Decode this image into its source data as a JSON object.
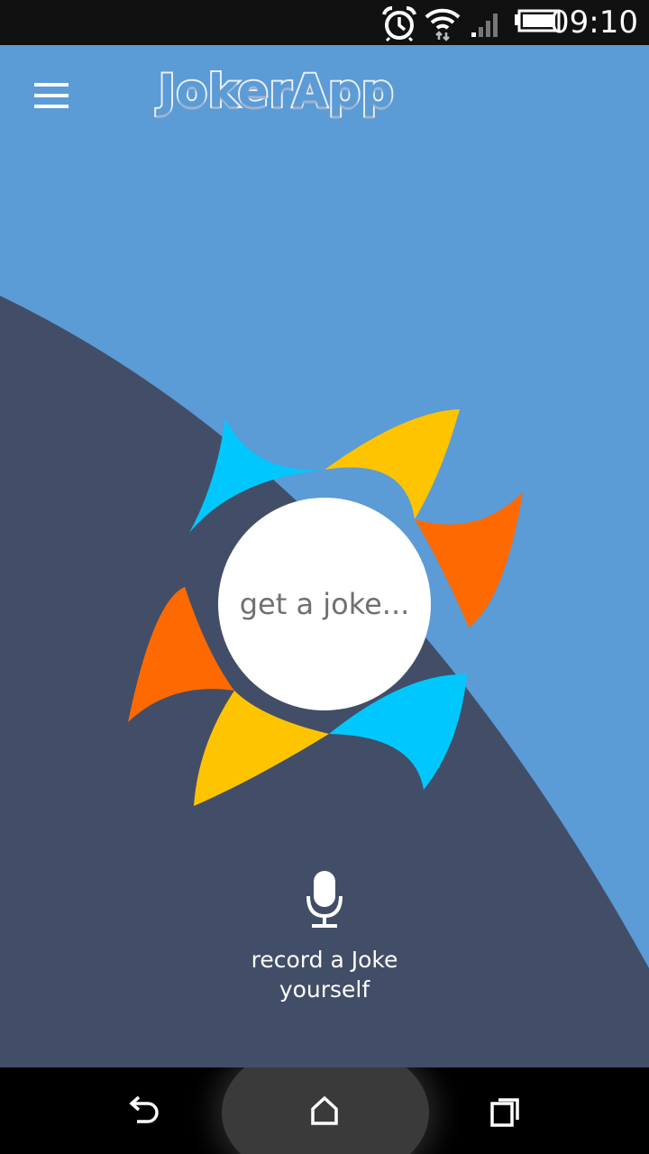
{
  "status_bar": {
    "time": "09:10",
    "icons": [
      "alarm-icon",
      "wifi-icon",
      "signal-icon",
      "battery-icon"
    ]
  },
  "header": {
    "title": "JokerApp",
    "menu_icon": "hamburger-menu-icon"
  },
  "main": {
    "get_joke_label": "get a joke...",
    "record_label": "record a Joke\nyourself",
    "record_icon": "microphone-icon"
  },
  "nav_bar": {
    "icons": [
      "back-icon",
      "home-icon",
      "recent-apps-icon"
    ]
  },
  "colors": {
    "background_light": "#5b9bd6",
    "background_dark": "#424e68",
    "logo_blue": "#00c8ff",
    "logo_yellow": "#ffc400",
    "logo_orange": "#ff6a00",
    "button_white": "#ffffff",
    "button_text": "#707070"
  }
}
